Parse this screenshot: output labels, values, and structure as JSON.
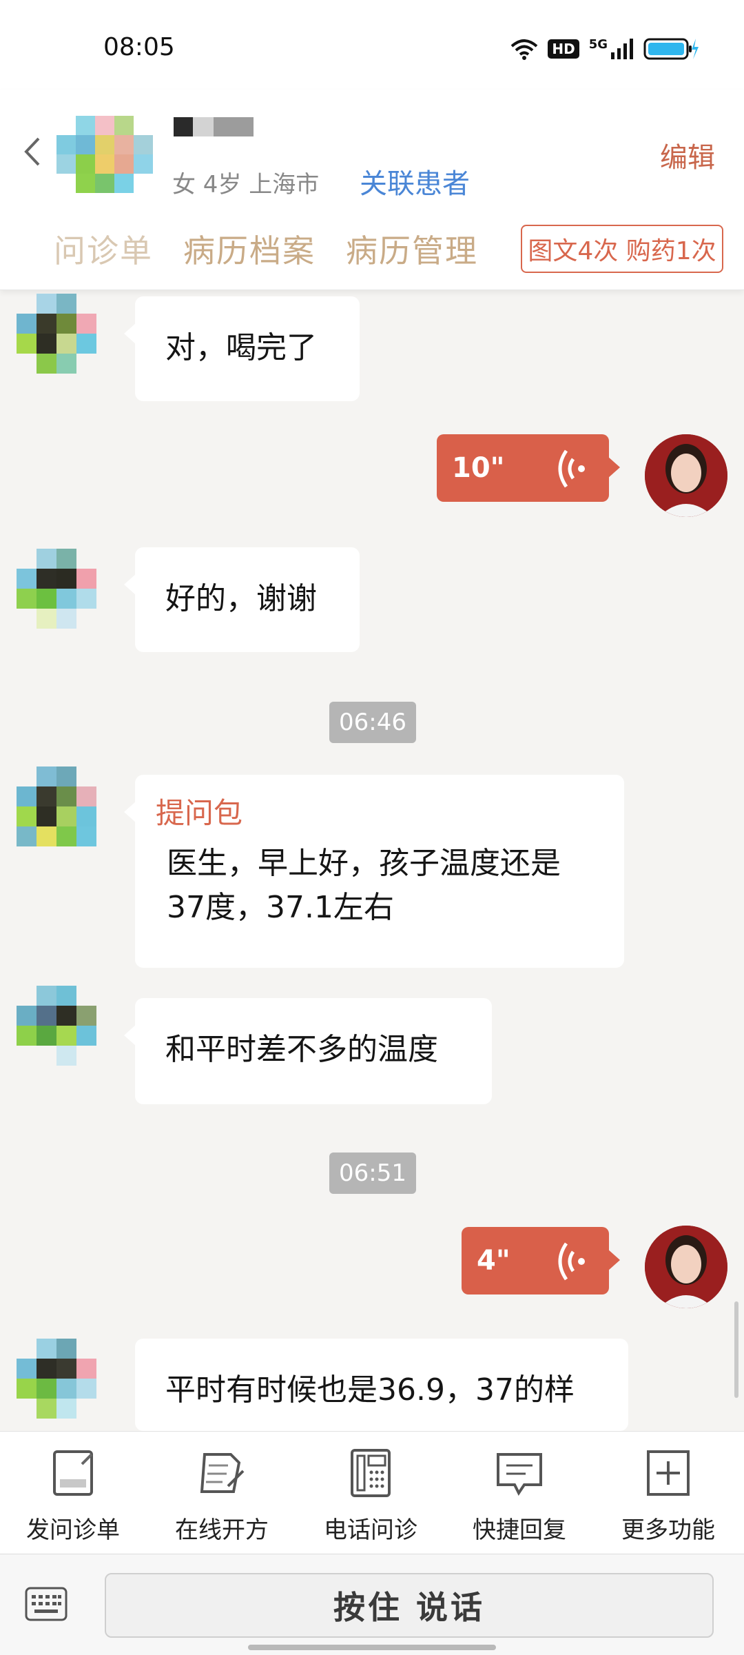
{
  "status_bar": {
    "time": "08:05",
    "hd": "HD",
    "network": "5G"
  },
  "header": {
    "patient_meta": "女 4岁  上海市",
    "link_patient": "关联患者",
    "edit": "编辑",
    "tabs": [
      "问诊单",
      "病历档案",
      "病历管理"
    ],
    "stats": "图文4次 购药1次"
  },
  "messages": [
    {
      "side": "left",
      "type": "text",
      "text": "对，喝完了"
    },
    {
      "side": "right",
      "type": "voice",
      "duration": "10\""
    },
    {
      "side": "left",
      "type": "text",
      "text": "好的，谢谢"
    },
    {
      "type": "time",
      "text": "06:46"
    },
    {
      "side": "left",
      "type": "card",
      "title": "提问包",
      "lines": [
        "医生，早上好，孩子温度还是",
        "37度，37.1左右"
      ]
    },
    {
      "side": "left",
      "type": "text",
      "text": "和平时差不多的温度"
    },
    {
      "type": "time",
      "text": "06:51"
    },
    {
      "side": "right",
      "type": "voice",
      "duration": "4\""
    },
    {
      "side": "left",
      "type": "text",
      "text": "平时有时候也是36.9，37的样"
    }
  ],
  "toolbar": [
    {
      "label": "发问诊单",
      "icon": "form-icon"
    },
    {
      "label": "在线开方",
      "icon": "prescription-icon"
    },
    {
      "label": "电话问诊",
      "icon": "phone-icon"
    },
    {
      "label": "快捷回复",
      "icon": "quick-reply-icon"
    },
    {
      "label": "更多功能",
      "icon": "plus-icon"
    }
  ],
  "input": {
    "talk": "按住 说话",
    "keyboard_icon": "keyboard-icon"
  },
  "colors": {
    "accent": "#d9604a",
    "link": "#4a86d6",
    "tab": "#c9ab87"
  }
}
